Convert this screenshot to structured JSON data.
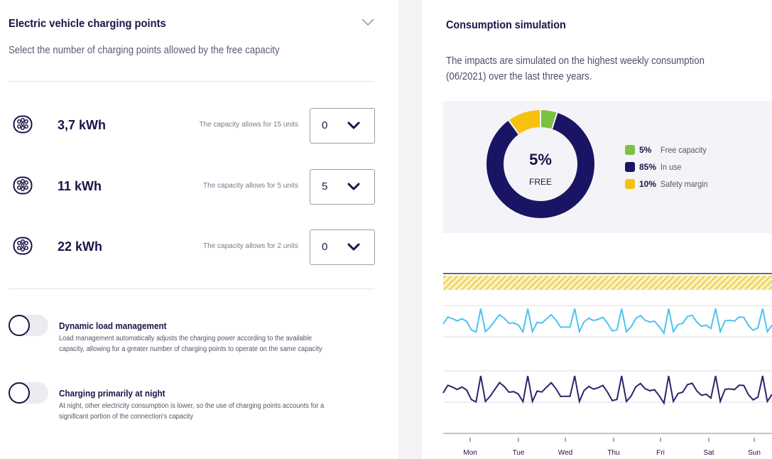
{
  "left_panel": {
    "title": "Electric vehicle charging points",
    "subtitle": "Select the number of charging points allowed by the free capacity",
    "chevron_icon": "chevron-down-icon",
    "charging_points": [
      {
        "power": "3,7 kWh",
        "note": "The capacity allows for 15 units",
        "value": "0",
        "icon": "ev-plug-icon"
      },
      {
        "power": "11 kWh",
        "note": "The capacity allows for 5 units",
        "value": "5",
        "icon": "ev-plug-icon"
      },
      {
        "power": "22 kWh",
        "note": "The capacity allows for 2 units",
        "value": "0",
        "icon": "ev-plug-icon"
      }
    ],
    "options": [
      {
        "title": "Dynamic load management",
        "description": "Load management automatically adjusts the charging power according to the available capacity, allowing for a greater number of charging points to operate on the same capacity",
        "enabled": false
      },
      {
        "title": "Charging primarily at night",
        "description": "At night, other electricity consumption is lower, so the use of charging points accounts for a significant portion of the connection's capacity",
        "enabled": false
      }
    ]
  },
  "right_panel": {
    "title": "Consumption simulation",
    "description": "The impacts are simulated on the highest weekly consumption (06/2021) over the last three years.",
    "donut": {
      "center_value": "5%",
      "center_label": "FREE",
      "segments": [
        {
          "pct": "5%",
          "label": "Free capacity",
          "value": 5,
          "color": "#7cc242"
        },
        {
          "pct": "85%",
          "label": "In use",
          "value": 85,
          "color": "#1a1464"
        },
        {
          "pct": "10%",
          "label": "Safety margin",
          "value": 10,
          "color": "#f7c20f"
        }
      ]
    },
    "colors": {
      "upper_line": "#4dc3ef",
      "lower_line": "#2c246b",
      "hatch": "#f3d65a"
    },
    "weekly_chart": {
      "days": [
        "Mon",
        "Tue",
        "Wed",
        "Thu",
        "Fri",
        "Sat",
        "Sun"
      ]
    }
  }
}
